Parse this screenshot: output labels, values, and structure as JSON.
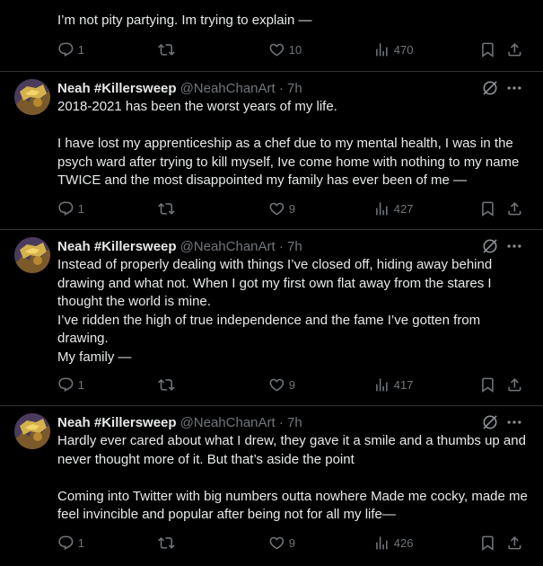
{
  "top_tweet": {
    "text": "I’m not pity partying. Im trying to explain —",
    "replies": "1",
    "retweets": "",
    "likes": "10",
    "views": "470"
  },
  "tweets": [
    {
      "name": "Neah #Killersweep",
      "handle": "@NeahChanArt · 7h",
      "text": "2018-2021 has been the worst years of my life.\n\nI have lost my apprenticeship as a chef due to my mental health, I was in the psych ward after trying to kill myself, Ive come home with nothing to my name TWICE and the most disappointed my family has ever been of me —",
      "replies": "1",
      "retweets": "",
      "likes": "9",
      "views": "427"
    },
    {
      "name": "Neah #Killersweep",
      "handle": "@NeahChanArt · 7h",
      "text": "Instead of properly dealing with things I’ve closed off, hiding away behind drawing and what not. When I got my first own flat away from the stares I thought the world is mine.\nI’ve ridden the high of true independence and the fame I’ve gotten from drawing.\nMy family —",
      "replies": "1",
      "retweets": "",
      "likes": "9",
      "views": "417"
    },
    {
      "name": "Neah #Killersweep",
      "handle": "@NeahChanArt · 7h",
      "text": "Hardly ever cared about what I drew, they gave it a smile and a thumbs up and never thought more of it. But that’s aside the point\n\nComing into Twitter with big numbers outta nowhere Made me cocky, made me feel invincible and popular after being not for all my life—",
      "replies": "1",
      "retweets": "",
      "likes": "9",
      "views": "426"
    }
  ],
  "icons": {
    "reply": "reply-icon",
    "retweet": "retweet-icon",
    "like": "like-icon",
    "views": "views-icon",
    "bookmark": "bookmark-icon",
    "share": "share-icon",
    "mute": "mute-icon",
    "more": "more-icon"
  },
  "colors": {
    "background": "#000000",
    "text": "#e7e9ea",
    "muted": "#71767b",
    "divider": "#2f3336"
  }
}
